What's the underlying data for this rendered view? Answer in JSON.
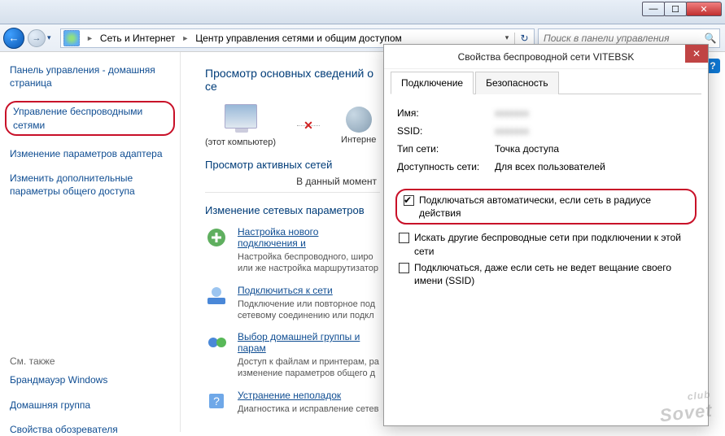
{
  "addressbar": {
    "seg1": "Сеть и Интернет",
    "seg2": "Центр управления сетями и общим доступом",
    "search_placeholder": "Поиск в панели управления"
  },
  "sidebar": {
    "home": "Панель управления - домашняя страница",
    "links": [
      "Управление беспроводными сетями",
      "Изменение параметров адаптера",
      "Изменить дополнительные параметры общего доступа"
    ],
    "seealso_hd": "См. также",
    "seealso": [
      "Брандмауэр Windows",
      "Домашняя группа",
      "Свойства обозревателя"
    ]
  },
  "main": {
    "heading": "Просмотр основных сведений о се",
    "this_pc": "(этот компьютер)",
    "internet": "Интерне",
    "active_hd": "Просмотр активных сетей",
    "active_sub": "В данный момент",
    "change_hd": "Изменение сетевых параметров",
    "tasks": [
      {
        "link": "Настройка нового подключения и",
        "desc": "Настройка беспроводного, широ\nили же настройка маршрутизатор"
      },
      {
        "link": "Подключиться к сети",
        "desc": "Подключение или повторное под\nсетевому соединению или подкл"
      },
      {
        "link": "Выбор домашней группы и парам",
        "desc": "Доступ к файлам и принтерам, ра\nизменение параметров общего д"
      },
      {
        "link": "Устранение неполадок",
        "desc": "Диагностика и исправление сетев"
      }
    ]
  },
  "dialog": {
    "title": "Свойства беспроводной сети VITEBSK",
    "tabs": [
      "Подключение",
      "Безопасность"
    ],
    "fields": {
      "name_k": "Имя:",
      "name_v": "xxxxxxx",
      "ssid_k": "SSID:",
      "ssid_v": "xxxxxxx",
      "type_k": "Тип сети:",
      "type_v": "Точка доступа",
      "avail_k": "Доступность сети:",
      "avail_v": "Для всех пользователей"
    },
    "checks": [
      "Подключаться автоматически, если сеть в радиусе действия",
      "Искать другие беспроводные сети при подключении к этой сети",
      "Подключаться, даже если сеть не ведет вещание своего имени (SSID)"
    ]
  },
  "watermark": {
    "club": "club",
    "sovet": "Sovet"
  }
}
